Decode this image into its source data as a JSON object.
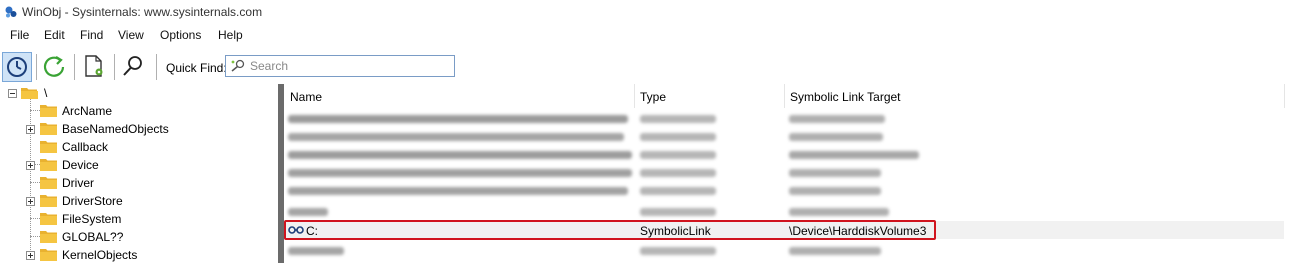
{
  "window": {
    "title": "WinObj - Sysinternals: www.sysinternals.com"
  },
  "menu": [
    "File",
    "Edit",
    "Find",
    "View",
    "Options",
    "Help"
  ],
  "toolbar": {
    "buttons": [
      "refresh-toggle-icon",
      "refresh-icon",
      "properties-icon",
      "find-icon"
    ],
    "quick_find_label": "Quick Find:",
    "search_placeholder": "Search"
  },
  "tree": {
    "root": "\\",
    "items": [
      {
        "label": "ArcName",
        "expandable": false
      },
      {
        "label": "BaseNamedObjects",
        "expandable": true
      },
      {
        "label": "Callback",
        "expandable": false
      },
      {
        "label": "Device",
        "expandable": true
      },
      {
        "label": "Driver",
        "expandable": false
      },
      {
        "label": "DriverStore",
        "expandable": true
      },
      {
        "label": "FileSystem",
        "expandable": false
      },
      {
        "label": "GLOBAL??",
        "expandable": false,
        "selected": true
      },
      {
        "label": "KernelObjects",
        "expandable": true
      }
    ]
  },
  "list": {
    "columns": [
      "Name",
      "Type",
      "Symbolic Link Target"
    ],
    "highlighted_row": {
      "name": "C:",
      "type": "SymbolicLink",
      "target": "\\Device\\HarddiskVolume3"
    }
  },
  "colors": {
    "highlight_border": "#d0141e",
    "folder": "#f5c542",
    "splitter": "#6b6b6b"
  }
}
